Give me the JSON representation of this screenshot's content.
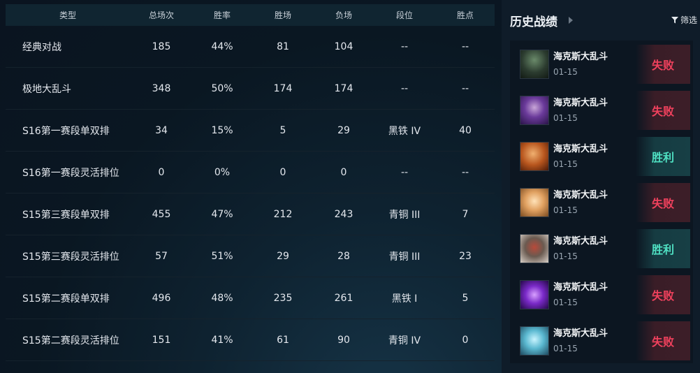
{
  "stats": {
    "columns": [
      "类型",
      "总场次",
      "胜率",
      "胜场",
      "负场",
      "段位",
      "胜点"
    ],
    "rows": [
      {
        "type": "经典对战",
        "total": "185",
        "rate": "44%",
        "wins": "81",
        "losses": "104",
        "rank": "--",
        "points": "--"
      },
      {
        "type": "极地大乱斗",
        "total": "348",
        "rate": "50%",
        "wins": "174",
        "losses": "174",
        "rank": "--",
        "points": "--"
      },
      {
        "type": "S16第一赛段单双排",
        "total": "34",
        "rate": "15%",
        "wins": "5",
        "losses": "29",
        "rank": "黑铁 IV",
        "points": "40"
      },
      {
        "type": "S16第一赛段灵活排位",
        "total": "0",
        "rate": "0%",
        "wins": "0",
        "losses": "0",
        "rank": "--",
        "points": "--"
      },
      {
        "type": "S15第三赛段单双排",
        "total": "455",
        "rate": "47%",
        "wins": "212",
        "losses": "243",
        "rank": "青铜 III",
        "points": "7"
      },
      {
        "type": "S15第三赛段灵活排位",
        "total": "57",
        "rate": "51%",
        "wins": "29",
        "losses": "28",
        "rank": "青铜 III",
        "points": "23"
      },
      {
        "type": "S15第二赛段单双排",
        "total": "496",
        "rate": "48%",
        "wins": "235",
        "losses": "261",
        "rank": "黑铁 I",
        "points": "5"
      },
      {
        "type": "S15第二赛段灵活排位",
        "total": "151",
        "rate": "41%",
        "wins": "61",
        "losses": "90",
        "rank": "青铜 IV",
        "points": "0"
      }
    ]
  },
  "history": {
    "title": "历史战绩",
    "filter_label": "筛选",
    "matches": [
      {
        "mode": "海克斯大乱斗",
        "date": "01-15",
        "result": "失败",
        "outcome": "lose",
        "avatar": "champion-avatar-0"
      },
      {
        "mode": "海克斯大乱斗",
        "date": "01-15",
        "result": "失败",
        "outcome": "lose",
        "avatar": "champion-avatar-1"
      },
      {
        "mode": "海克斯大乱斗",
        "date": "01-15",
        "result": "胜利",
        "outcome": "win",
        "avatar": "champion-avatar-2"
      },
      {
        "mode": "海克斯大乱斗",
        "date": "01-15",
        "result": "失败",
        "outcome": "lose",
        "avatar": "champion-avatar-3"
      },
      {
        "mode": "海克斯大乱斗",
        "date": "01-15",
        "result": "胜利",
        "outcome": "win",
        "avatar": "champion-avatar-4"
      },
      {
        "mode": "海克斯大乱斗",
        "date": "01-15",
        "result": "失败",
        "outcome": "lose",
        "avatar": "champion-avatar-5"
      },
      {
        "mode": "海克斯大乱斗",
        "date": "01-15",
        "result": "失败",
        "outcome": "lose",
        "avatar": "champion-avatar-6"
      }
    ]
  },
  "colors": {
    "lose": "#f0415d",
    "win": "#4fe0c2",
    "panel_bg": "#0f1c29",
    "header_bg": "#102531"
  }
}
